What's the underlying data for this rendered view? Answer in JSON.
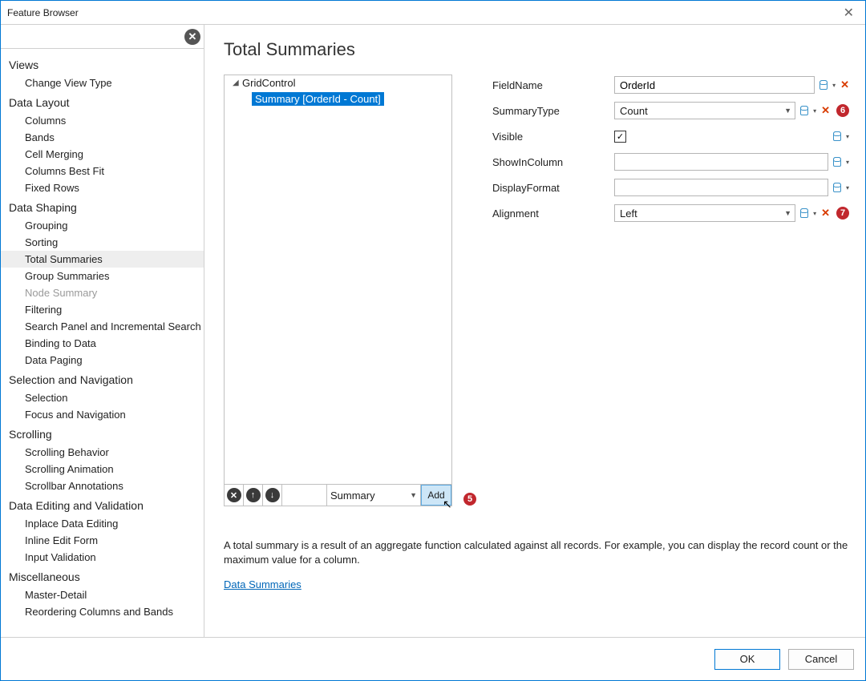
{
  "window": {
    "title": "Feature Browser"
  },
  "search": {
    "value": "",
    "placeholder": ""
  },
  "sidebar": [
    {
      "label": "Views",
      "items": [
        "Change View Type"
      ]
    },
    {
      "label": "Data Layout",
      "items": [
        "Columns",
        "Bands",
        "Cell Merging",
        "Columns Best Fit",
        "Fixed Rows"
      ]
    },
    {
      "label": "Data Shaping",
      "items": [
        "Grouping",
        "Sorting",
        "Total Summaries",
        "Group Summaries",
        "Node Summary",
        "Filtering",
        "Search Panel and Incremental Search",
        "Binding to Data",
        "Data Paging"
      ],
      "selected": "Total Summaries",
      "disabled": [
        "Node Summary"
      ]
    },
    {
      "label": "Selection and Navigation",
      "items": [
        "Selection",
        "Focus and Navigation"
      ]
    },
    {
      "label": "Scrolling",
      "items": [
        "Scrolling Behavior",
        "Scrolling Animation",
        "Scrollbar Annotations"
      ]
    },
    {
      "label": "Data Editing and Validation",
      "items": [
        "Inplace Data Editing",
        "Inline Edit Form",
        "Input Validation"
      ]
    },
    {
      "label": "Miscellaneous",
      "items": [
        "Master-Detail",
        "Reordering Columns and Bands"
      ]
    }
  ],
  "main": {
    "title": "Total Summaries",
    "tree": {
      "root": "GridControl",
      "child": "Summary [OrderId - Count]"
    },
    "toolbar": {
      "select_value": "Summary",
      "add_label": "Add"
    },
    "props": {
      "FieldName": {
        "label": "FieldName",
        "value": "OrderId",
        "type": "text",
        "hasX": true
      },
      "SummaryType": {
        "label": "SummaryType",
        "value": "Count",
        "type": "combo",
        "hasX": true,
        "badge": "6"
      },
      "Visible": {
        "label": "Visible",
        "value": true,
        "type": "check"
      },
      "ShowInColumn": {
        "label": "ShowInColumn",
        "value": "",
        "type": "text"
      },
      "DisplayFormat": {
        "label": "DisplayFormat",
        "value": "",
        "type": "text"
      },
      "Alignment": {
        "label": "Alignment",
        "value": "Left",
        "type": "combo",
        "hasX": true,
        "badge": "7"
      }
    },
    "description": "A total summary is a result of an aggregate function calculated against all records. For example, you can display the record count or the maximum value for a column.",
    "link": "Data Summaries",
    "add_badge": "5"
  },
  "footer": {
    "ok": "OK",
    "cancel": "Cancel"
  }
}
